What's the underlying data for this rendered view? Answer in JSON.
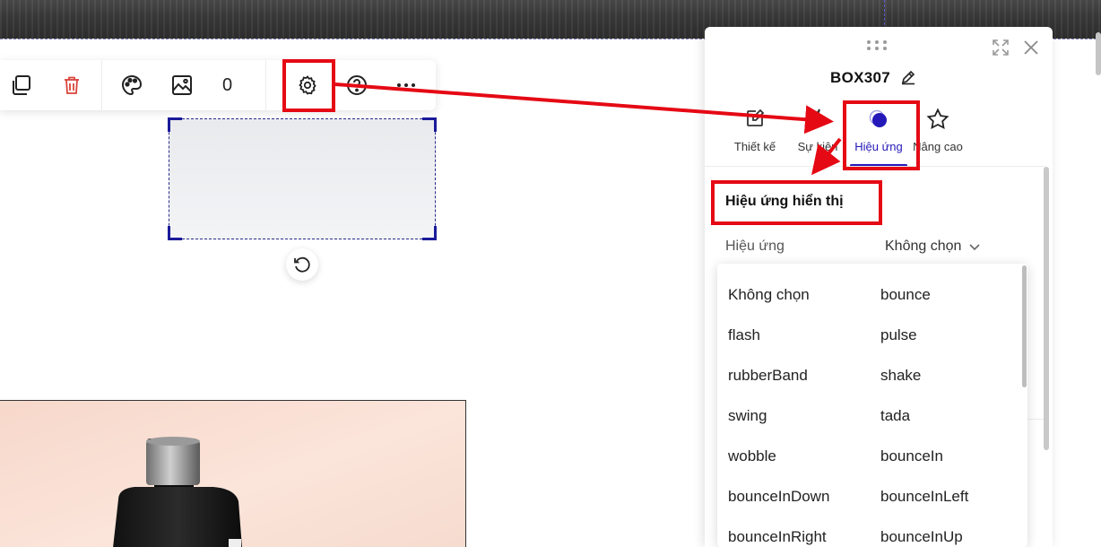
{
  "toolbar": {
    "buttons": [
      {
        "name": "copy-icon"
      },
      {
        "name": "trash-icon"
      },
      {
        "name": "palette-icon"
      },
      {
        "name": "image-icon"
      },
      {
        "name": "settings-gear-icon"
      },
      {
        "name": "help-icon"
      },
      {
        "name": "more-horizontal-icon"
      }
    ],
    "count": "0",
    "trash_color": "#d9443a"
  },
  "panel": {
    "title": "BOX307",
    "tabs": [
      {
        "label": "Thiết kế",
        "icon": "edit-square-icon"
      },
      {
        "label": "Sự kiện",
        "icon": "lightning-icon"
      },
      {
        "label": "Hiệu ứng",
        "icon": "effect-circle-icon",
        "active": true
      },
      {
        "label": "Nâng cao",
        "icon": "star-icon"
      }
    ],
    "accent_color": "#2418b8",
    "section_title": "Hiệu ứng hiển thị",
    "effect_field": {
      "label": "Hiệu ứng",
      "value": "Không chọn"
    }
  },
  "dropdown": {
    "options": [
      "Không chọn",
      "bounce",
      "flash",
      "pulse",
      "rubberBand",
      "shake",
      "swing",
      "tada",
      "wobble",
      "bounceIn",
      "bounceInDown",
      "bounceInLeft",
      "bounceInRight",
      "bounceInUp"
    ]
  },
  "annotation_color": "#e50914"
}
